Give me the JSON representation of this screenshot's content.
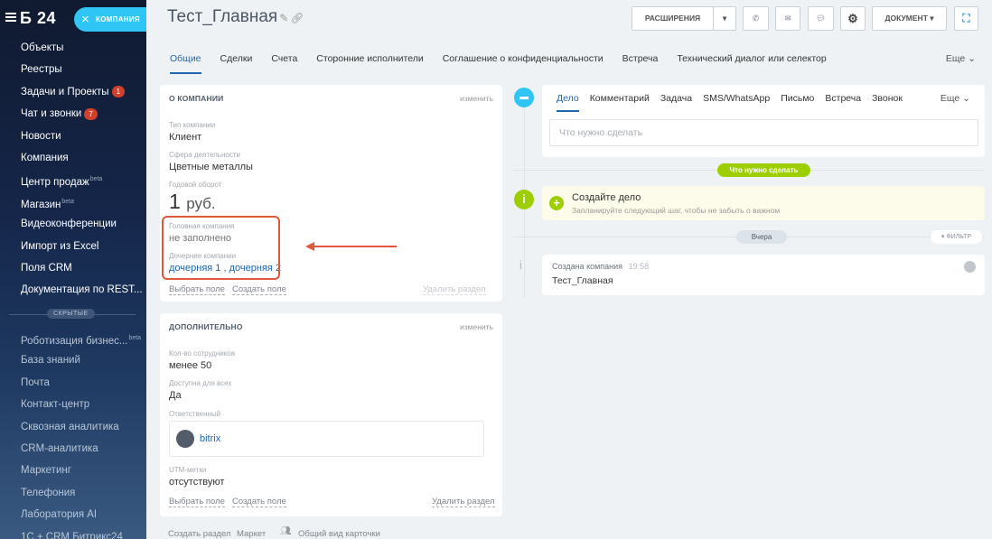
{
  "sidebar": {
    "logo": "Б 24",
    "items": [
      {
        "label": "Объекты"
      },
      {
        "label": "Реестры"
      },
      {
        "label": "Задачи и Проекты",
        "count": "1"
      },
      {
        "label": "Чат и звонки",
        "count": "7"
      },
      {
        "label": "Новости"
      },
      {
        "label": "Компания"
      },
      {
        "label": "Центр продаж",
        "sup": "beta"
      },
      {
        "label": "Магазин",
        "sup": "beta"
      },
      {
        "label": "Видеоконференции"
      },
      {
        "label": "Импорт из Excel"
      },
      {
        "label": "Поля CRM"
      },
      {
        "label": "Документация по REST..."
      }
    ],
    "hidden_label": "СКРЫТЫЕ",
    "hidden_items": [
      {
        "label": "Роботизация бизнес...",
        "sup": "beta"
      },
      {
        "label": "База знаний"
      },
      {
        "label": "Почта"
      },
      {
        "label": "Контакт-центр"
      },
      {
        "label": "Сквозная аналитика"
      },
      {
        "label": "CRM-аналитика"
      },
      {
        "label": "Маркетинг"
      },
      {
        "label": "Телефония"
      },
      {
        "label": "Лаборатория AI"
      },
      {
        "label": "1С + CRM Битрикс24"
      }
    ]
  },
  "entity_tab": {
    "label": "КОМПАНИЯ"
  },
  "header": {
    "title": "Тест_Главная",
    "extensions_label": "РАСШИРЕНИЯ",
    "document_label": "ДОКУМЕНТ"
  },
  "tabs": [
    "Общие",
    "Сделки",
    "Счета",
    "Сторонние исполнители",
    "Соглашение о конфиденциальности",
    "Встреча",
    "Технический диалог или селектор"
  ],
  "tabs_more": "Еще",
  "about": {
    "title": "О КОМПАНИИ",
    "change": "изменить",
    "fields": {
      "type_label": "Тип компании",
      "type_value": "Клиент",
      "industry_label": "Сфера деятельности",
      "industry_value": "Цветные металлы",
      "revenue_label": "Годовой оборот",
      "revenue_amount": "1",
      "revenue_currency": "руб.",
      "parent_label": "Головная компания",
      "parent_value": "не заполнено",
      "children_label": "Дочерние компании",
      "child1": "дочерняя 1",
      "sep": ",",
      "child2": "дочерняя 2"
    },
    "select_field": "Выбрать поле",
    "create_field": "Создать поле",
    "delete_section": "Удалить раздел"
  },
  "additional": {
    "title": "ДОПОЛНИТЕЛЬНО",
    "change": "изменить",
    "employees_label": "Кол-во сотрудников",
    "employees_value": "менее 50",
    "available_label": "Доступна для всех",
    "available_value": "Да",
    "responsible_label": "Ответственный",
    "responsible_value": "bitrix",
    "utm_label": "UTM-метки",
    "utm_value": "отсутствуют",
    "select_field": "Выбрать поле",
    "create_field": "Создать поле",
    "delete_section": "Удалить раздел"
  },
  "footer": {
    "create_section": "Создать раздел",
    "market": "Маркет",
    "card_view": "Общий вид карточки"
  },
  "activity": {
    "tabs": [
      "Дело",
      "Комментарий",
      "Задача",
      "SMS/WhatsApp",
      "Письмо",
      "Встреча",
      "Звонок"
    ],
    "more": "Еще",
    "placeholder": "Что нужно сделать",
    "todo_badge": "Что нужно сделать",
    "create_title": "Создайте дело",
    "create_hint": "Запланируйте следующий шаг, чтобы не забыть о важном",
    "yesterday": "Вчера",
    "filter": "ФИЛЬТР",
    "event_title": "Создана компания",
    "event_time": "19:58",
    "event_name": "Тест_Главная"
  },
  "colors": {
    "accent": "#2067b0",
    "tab_blue": "#2fc6f6",
    "green": "#9dcf00",
    "highlight": "#e0573e"
  }
}
